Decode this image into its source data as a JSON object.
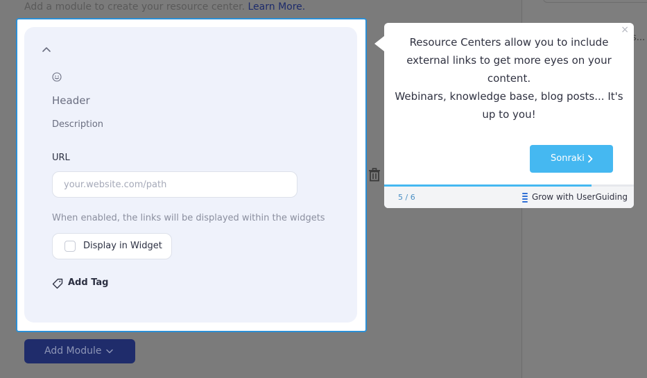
{
  "background": {
    "intro_text": "Add a module to create your resource center.",
    "learn_more": "Learn More.",
    "side_snippet": "s..."
  },
  "module": {
    "header": "Header",
    "description": "Description",
    "url_label": "URL",
    "url_placeholder": "your.website.com/path",
    "hint": "When enabled, the links will be displayed within the widgets",
    "display_in_widget": "Display in Widget",
    "add_tag": "Add Tag"
  },
  "add_module_button": "Add Module",
  "tooltip": {
    "line1": "Resource Centers allow you to include external links to get more eyes on your content.",
    "line2": "Webinars, knowledge base, blog posts... It's up to you!",
    "next_label": "Sonraki",
    "step": "5 / 6",
    "progress": 0.83,
    "brand": "Grow with UserGuiding",
    "close_symbol": "×"
  },
  "colors": {
    "accent": "#45b8f1",
    "frame_border": "#2b8fd6",
    "primary_dark": "#1f2c6b",
    "card_bg": "#eff2fb"
  },
  "icons": [
    "chevron-up-icon",
    "smiley-icon",
    "tag-icon",
    "trash-icon",
    "chevron-down-icon",
    "chevron-right-icon",
    "close-icon",
    "userguiding-logo-icon"
  ]
}
